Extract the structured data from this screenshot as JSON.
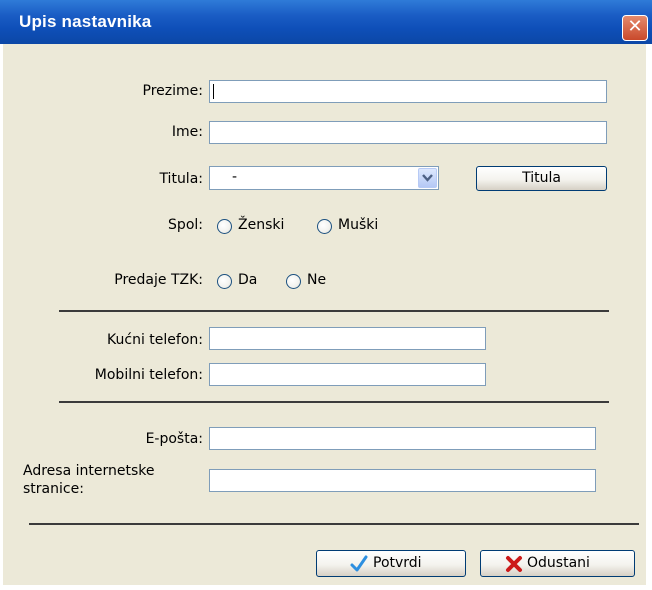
{
  "window": {
    "title": "Upis nastavnika",
    "close_glyph": "✕"
  },
  "form": {
    "prezime": {
      "label": "Prezime:",
      "value": ""
    },
    "ime": {
      "label": "Ime:",
      "value": ""
    },
    "titula": {
      "label": "Titula:",
      "selected": "-",
      "button_label": "Titula"
    },
    "spol": {
      "label": "Spol:",
      "options": [
        "Ženski",
        "Muški"
      ]
    },
    "tzk": {
      "label": "Predaje TZK:",
      "options": [
        "Da",
        "Ne"
      ]
    },
    "kucni_telefon": {
      "label": "Kućni telefon:",
      "value": ""
    },
    "mobilni_telefon": {
      "label": "Mobilni telefon:",
      "value": ""
    },
    "eposta": {
      "label": "E-pošta:",
      "value": ""
    },
    "adresa": {
      "label_line1": "Adresa internetske",
      "label_line2": "stranice:",
      "value": ""
    }
  },
  "actions": {
    "potvrdi_label": "Potvrdi",
    "odustani_label": "Odustani",
    "potvrdi_icon": "checkmark-icon",
    "odustani_icon": "red-x-icon"
  },
  "colors": {
    "titlebar": "#0e4fb8",
    "dialog_bg": "#ece9d8",
    "close": "#c9492b"
  }
}
